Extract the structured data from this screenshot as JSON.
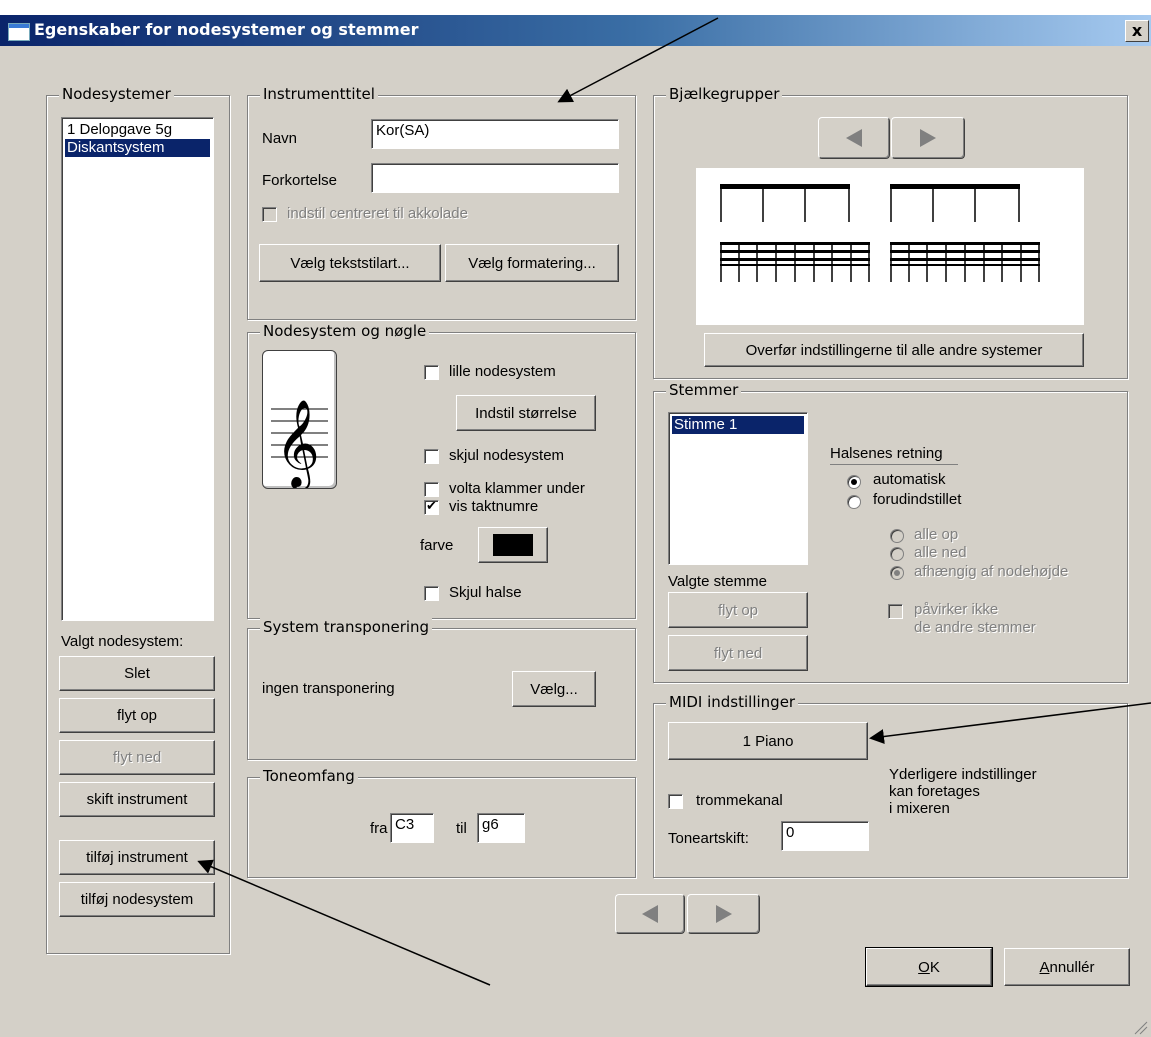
{
  "window": {
    "title": "Egenskaber for nodesystemer og stemmer",
    "close_symbol": "x"
  },
  "nodesystemer": {
    "legend": "Nodesystemer",
    "items": [
      {
        "label": "1 Delopgave 5g",
        "selected": false
      },
      {
        "label": "Diskantsystem",
        "selected": true
      }
    ],
    "valgt_label": "Valgt nodesystem:",
    "buttons": {
      "slet": "Slet",
      "flyt_op": "flyt op",
      "flyt_ned": "flyt ned",
      "skift_instrument": "skift instrument",
      "tilfoej_instrument": "tilføj instrument",
      "tilfoej_nodesystem": "tilføj nodesystem"
    }
  },
  "instrumenttitel": {
    "legend": "Instrumenttitel",
    "navn_label": "Navn",
    "navn_value": "Kor(SA)",
    "forkortelse_label": "Forkortelse",
    "forkortelse_value": "",
    "center_label": "indstil centreret til akkolade",
    "btn_tekststilart": "Vælg tekststilart...",
    "btn_formatering": "Vælg formatering..."
  },
  "nodesystem_noegle": {
    "legend": "Nodesystem og nøgle",
    "clef_icon": "treble-clef-icon",
    "clef_glyph": "𝄞",
    "lille_label": "lille nodesystem",
    "lille_checked": false,
    "btn_stoerrelse": "Indstil størrelse",
    "skjul_label": "skjul nodesystem",
    "skjul_checked": false,
    "volta_label": "volta klammer under",
    "volta_checked": false,
    "taktnumre_label": "vis taktnumre",
    "taktnumre_checked": true,
    "check_glyph": "✔",
    "farve_label": "farve",
    "farve_color": "#000000",
    "skjul_halse_label": "Skjul halse",
    "skjul_halse_checked": false
  },
  "transponering": {
    "legend": "System transponering",
    "value": "ingen transponering",
    "btn": "Vælg..."
  },
  "toneomfang": {
    "legend": "Toneomfang",
    "fra_label": "fra",
    "fra_value": "C3",
    "til_label": "til",
    "til_value": "g6"
  },
  "bjaelkegrupper": {
    "legend": "Bjælkegrupper",
    "prev_icon": "arrow-left-icon",
    "next_icon": "arrow-right-icon",
    "btn_overfoer": "Overfør indstillingerne til alle andre systemer"
  },
  "stemmer": {
    "legend": "Stemmer",
    "items": [
      {
        "label": "Stimme 1",
        "selected": true
      }
    ],
    "valgte_label": "Valgte stemme",
    "btn_flyt_op": "flyt op",
    "btn_flyt_ned": "flyt ned",
    "halse_title": "Halsenes retning",
    "radio_automatisk": "automatisk",
    "radio_forudindstillet": "forudindstillet",
    "radio_alle_op": "alle op",
    "radio_alle_ned": "alle ned",
    "radio_afhaengig": "afhængig af nodehøjde",
    "selected_direction": "automatisk",
    "paavirker_line1": "påvirker ikke",
    "paavirker_line2": "de andre stemmer"
  },
  "midi": {
    "legend": "MIDI indstillinger",
    "btn_instrument": "1 Piano",
    "trommekanal_label": "trommekanal",
    "trommekanal_checked": false,
    "toneartskift_label": "Toneartskift:",
    "toneartskift_value": "0",
    "note_line1": "Yderligere indstillinger",
    "note_line2": "kan foretages",
    "note_line3": "i mixeren"
  },
  "footer": {
    "prev_icon": "arrow-left-icon",
    "next_icon": "arrow-right-icon",
    "ok_mnemonic": "O",
    "ok_rest": "K",
    "cancel_mnemonic": "A",
    "cancel_rest": "nnullér"
  }
}
